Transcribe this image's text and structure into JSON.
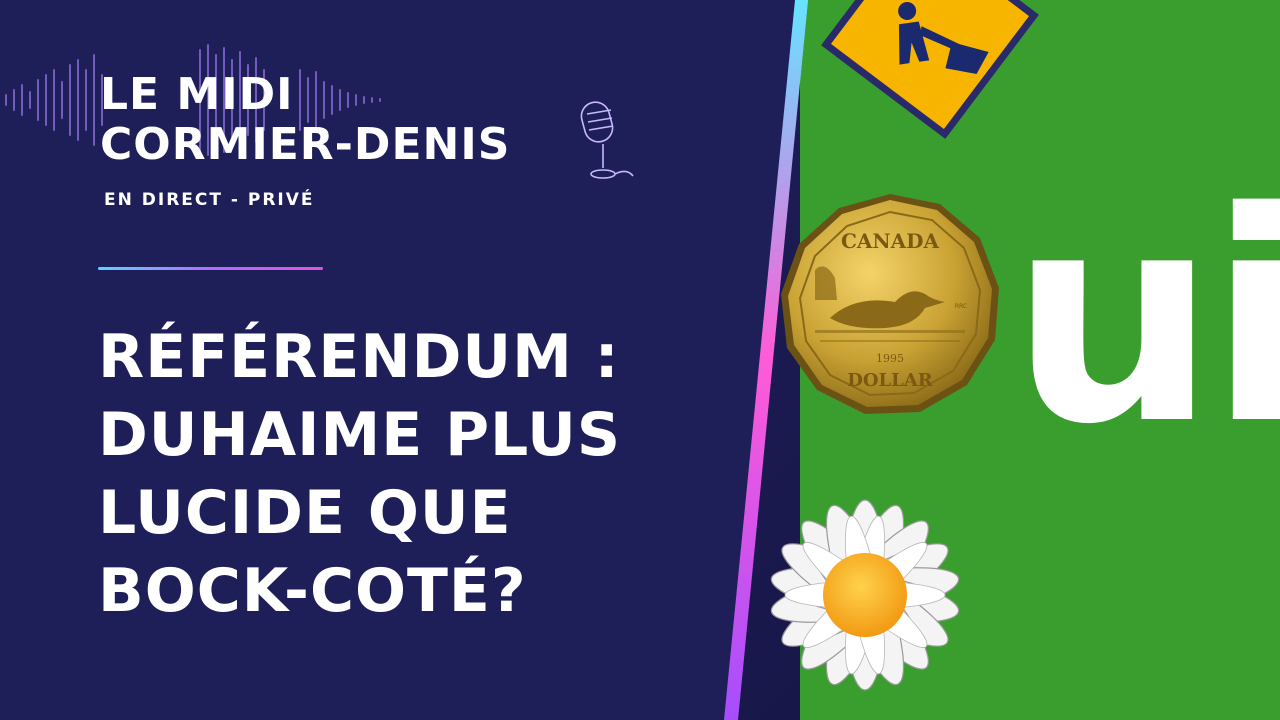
{
  "show": {
    "title_line1": "LE MIDI",
    "title_line2": "CORMIER-DENIS",
    "subtitle": "EN DIRECT - PRIVÉ"
  },
  "headline": {
    "line1": "RÉFÉRENDUM :",
    "line2": "DUHAIME PLUS",
    "line3": "LUCIDE QUE",
    "line4": "BOCK-COTÉ?"
  },
  "image": {
    "coin_country": "CANADA",
    "coin_year": "1995",
    "coin_denomination": "DOLLAR",
    "coin_mark": "RRC",
    "poster_text": "ui"
  },
  "colors": {
    "panel_background": "#1e1f55",
    "poster_green": "#3a9e2f",
    "accent_cyan": "#5fd3ff",
    "accent_magenta": "#e254d8"
  },
  "icons": [
    "waveform-icon",
    "microphone-icon",
    "roadwork-sign-icon",
    "loonie-coin-icon",
    "daisy-icon"
  ]
}
